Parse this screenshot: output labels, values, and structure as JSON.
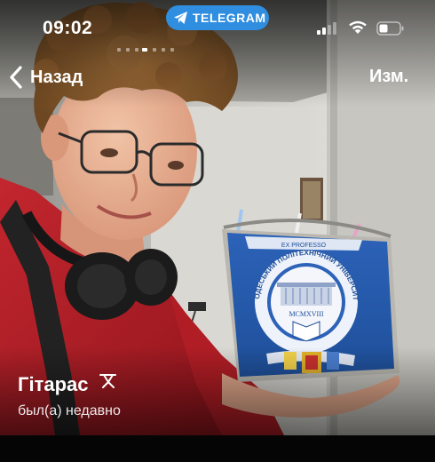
{
  "status_bar": {
    "time": "09:02",
    "app_pill_label": "TELEGRAM",
    "app_pill_color": "#2f8ee0",
    "signal_icon": "signal-icon",
    "wifi_icon": "wifi-icon",
    "battery_icon": "battery-icon"
  },
  "photo_pager": {
    "count": 7,
    "active_index": 0
  },
  "nav": {
    "back_label": "Назад",
    "edit_label": "Изм."
  },
  "profile": {
    "name": "Гітарас",
    "name_icon": "tools-icon",
    "last_seen": "был(а) недавно"
  },
  "photo": {
    "description_icon": "profile-photo",
    "emblem": {
      "ribbon_text": "EX PROFESSO",
      "ring_text": "ОДЕСЬКИЙ ПОЛІТЕХНІЧНИЙ УНІВЕРСИТЕТ",
      "year": "MCMXVIII"
    }
  }
}
